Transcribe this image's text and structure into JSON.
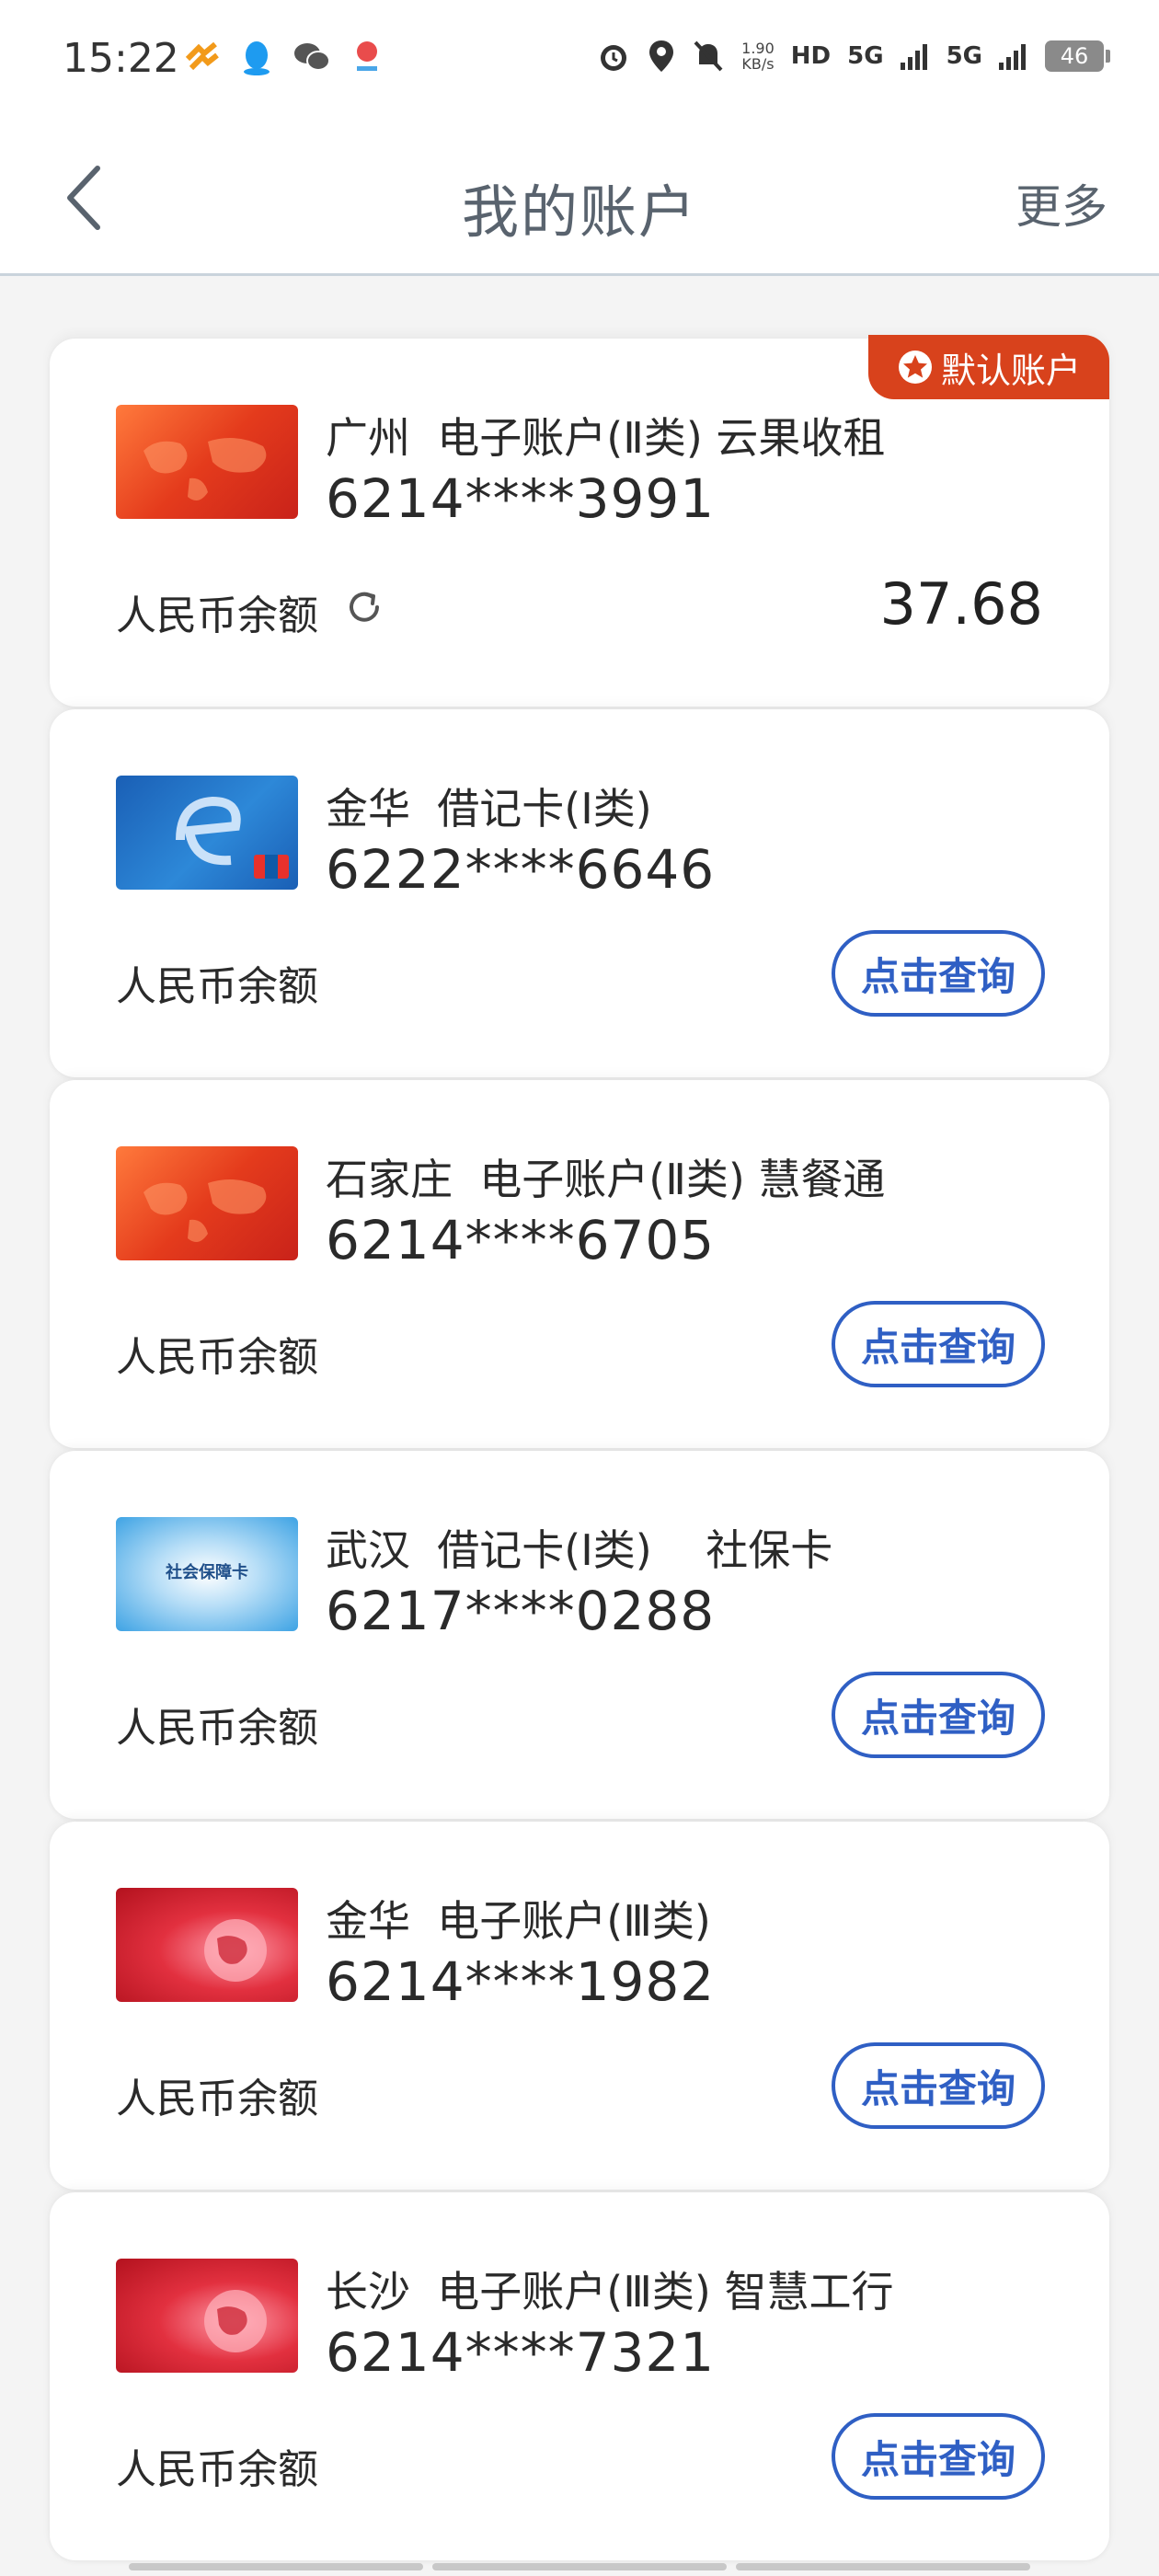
{
  "status_bar": {
    "time": "15:22",
    "net_speed_value": "1.90",
    "net_speed_unit": "KB/s",
    "hd": "HD",
    "sig1": "5G",
    "sig2": "5G",
    "battery": "46"
  },
  "header": {
    "title": "我的账户",
    "more_label": "更多"
  },
  "default_badge": "默认账户",
  "balance_label": "人民币余额",
  "query_label": "点击查询",
  "accounts": [
    {
      "title": "广州  电子账户(Ⅱ类) 云果收租",
      "number": "6214****3991",
      "balance": "37.68",
      "card_style": "red"
    },
    {
      "title": "金华  借记卡(Ⅰ类)",
      "number": "6222****6646",
      "card_style": "blue"
    },
    {
      "title": "石家庄  电子账户(Ⅱ类) 慧餐通",
      "number": "6214****6705",
      "card_style": "red"
    },
    {
      "title": "武汉  借记卡(Ⅰ类)    社保卡",
      "number": "6217****0288",
      "card_style": "sky",
      "card_text": "社会保障卡"
    },
    {
      "title": "金华  电子账户(Ⅲ类)",
      "number": "6214****1982",
      "card_style": "pink"
    },
    {
      "title": "长沙  电子账户(Ⅲ类) 智慧工行",
      "number": "6214****7321",
      "card_style": "pink"
    }
  ],
  "colors": {
    "accent": "#2f5fc4",
    "badge": "#d8421c",
    "title_text": "#59636e"
  }
}
